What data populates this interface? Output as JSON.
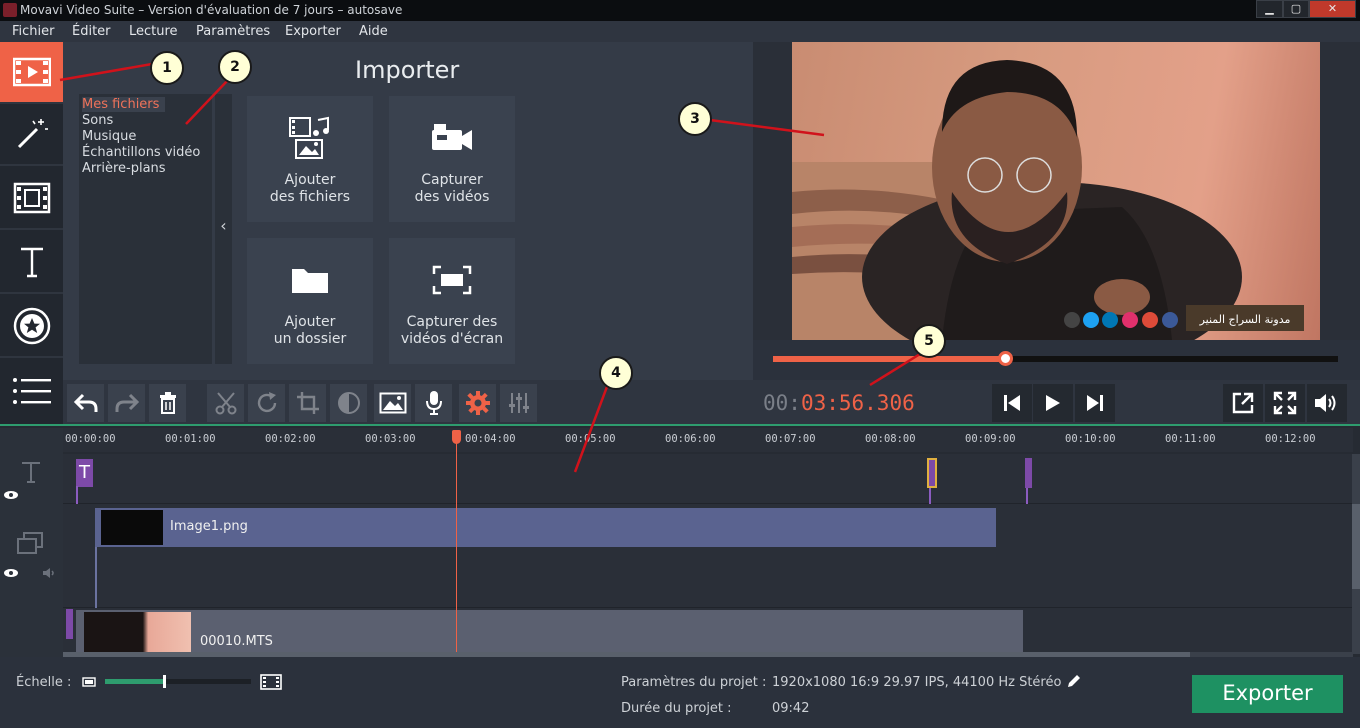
{
  "window": {
    "title": "Movavi Video Suite – Version d'évaluation de 7 jours – autosave",
    "minimize": "▁",
    "maximize": "▢",
    "close": "✕"
  },
  "menu": [
    "Fichier",
    "Éditer",
    "Lecture",
    "Paramètres",
    "Exporter",
    "Aide"
  ],
  "left_tools": [
    "import-icon",
    "magic-wand-icon",
    "filmstrip-icon",
    "text-icon",
    "sticker-star-icon",
    "list-icon"
  ],
  "importer": {
    "title": "Importer",
    "categories": [
      "Mes fichiers",
      "Sons",
      "Musique",
      "Échantillons vidéo",
      "Arrière-plans"
    ],
    "selected": "Mes fichiers",
    "collapse": "‹",
    "tiles": [
      {
        "line1": "Ajouter",
        "line2": "des fichiers",
        "icon": "media-files-icon"
      },
      {
        "line1": "Capturer",
        "line2": "des vidéos",
        "icon": "camera-icon"
      },
      {
        "line1": "Ajouter",
        "line2": "un dossier",
        "icon": "folder-icon"
      },
      {
        "line1": "Capturer des",
        "line2": "vidéos d'écran",
        "icon": "screen-capture-icon"
      }
    ]
  },
  "preview": {
    "watermark": "مدونة السراج المنير",
    "seek_progress": 0.41
  },
  "player": {
    "timecode_dim": "00:",
    "timecode_active": "03:56.306"
  },
  "callouts": [
    "1",
    "2",
    "3",
    "4",
    "5"
  ],
  "timeline": {
    "ticks": [
      "00:00:00",
      "00:01:00",
      "00:02:00",
      "00:03:00",
      "00:04:00",
      "00:05:00",
      "00:06:00",
      "00:07:00",
      "00:08:00",
      "00:09:00",
      "00:10:00",
      "00:11:00",
      "00:12:00"
    ],
    "title_clip_label": "T",
    "image_clip": "Image1.png",
    "video_clip": "00010.MTS"
  },
  "status": {
    "scale_label": "Échelle :",
    "zoom_level": 0.4,
    "params_label": "Paramètres du projet :",
    "params_value": "1920x1080 16:9 29.97 IPS, 44100 Hz Stéréo",
    "duration_label": "Durée du projet :",
    "duration_value": "09:42",
    "export_label": "Exporter"
  },
  "colors": {
    "accent": "#ef6247",
    "export": "#1e9162",
    "playhead": "#ef6247"
  }
}
